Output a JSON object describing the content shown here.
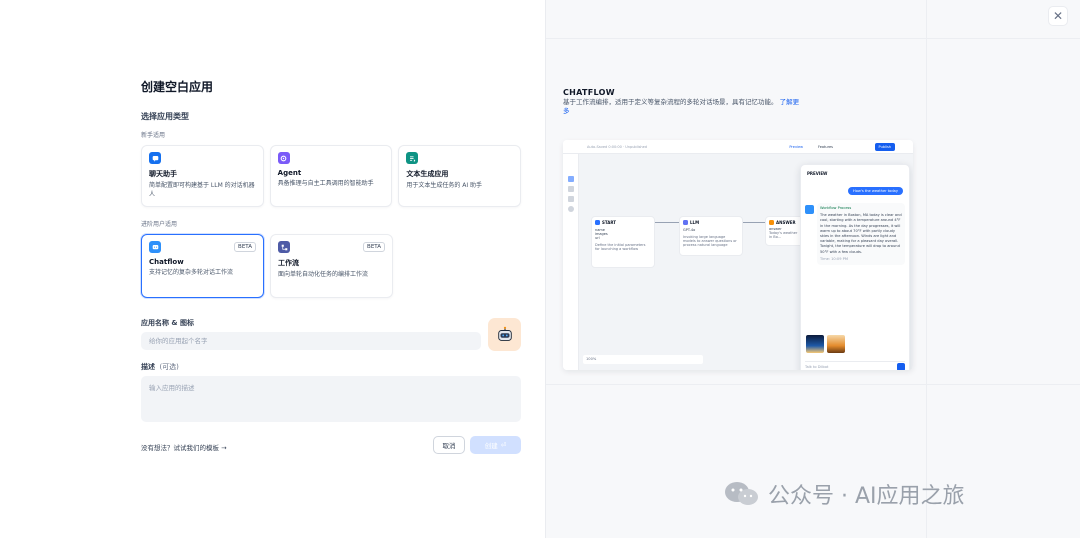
{
  "form": {
    "title": "创建空白应用",
    "type_section": "选择应用类型",
    "beginner_label": "新手适用",
    "advanced_label": "进阶用户适用",
    "beginner_cards": [
      {
        "title": "聊天助手",
        "desc": "简单配置即可构建基于 LLM 的对话机器人",
        "icon": "chat-bubble-icon",
        "color": "#1570ef"
      },
      {
        "title": "Agent",
        "desc": "具备推理与自主工具调用的智能助手",
        "icon": "agent-icon",
        "color": "#7a5af8"
      },
      {
        "title": "文本生成应用",
        "desc": "用于文本生成任务的 AI 助手",
        "icon": "text-generator-icon",
        "color": "#0e9384"
      }
    ],
    "advanced_cards": [
      {
        "title": "Chatflow",
        "desc": "支持记忆的复杂多轮对话工作流",
        "badge": "BETA",
        "icon": "chatflow-icon",
        "color": "#2e90fa"
      },
      {
        "title": "工作流",
        "desc": "面向单轮自动化任务的编排工作流",
        "badge": "BETA",
        "icon": "workflow-icon",
        "color": "#4e5ba6"
      }
    ],
    "name_label": "应用名称 & 图标",
    "name_placeholder": "给你的应用起个名字",
    "avatar_icon": "robot-icon",
    "desc_label": "描述",
    "desc_optional": "(可选)",
    "desc_placeholder": "输入应用的描述",
    "template_link": "没有想法？试试我们的模板",
    "cancel": "取消",
    "create": "创建"
  },
  "preview": {
    "title": "CHATFLOW",
    "desc": "基于工作流编排，适用于定义等复杂流程的多轮对话场景，具有记忆功能。",
    "link": "了解更多",
    "shot": {
      "topbar": "Auto-Saved 0:00:00 · Unpublished",
      "btn_preview": "Preview",
      "btn_features": "Features",
      "btn_publish": "Publish",
      "node_start": "START",
      "start_rows": [
        "name",
        "images",
        "url"
      ],
      "start_note": "Define the initial parameters for launching a workflow",
      "node_llm": "LLM",
      "llm_model": "GPT-4o",
      "llm_note": "Invoking large language models to answer questions or process natural language",
      "node_answer": "ANSWER",
      "answer_label": "answer",
      "answer_text": "Today's weather in Bo...",
      "panel_title": "PREVIEW",
      "user_msg": "How's the weather today",
      "workflow_process": "Workflow Process",
      "bot_answer": "The weather in Boston, MA today is clear and cool, starting with a temperature around 4°F in the morning. As the day progresses, it will warm up to about 70°F with partly cloudy skies in the afternoon. Winds are light and variable, making for a pleasant day overall. Tonight, the temperature will drop to around 50°F with a few clouds.",
      "time": "Time: 10:09 PM",
      "input_placeholder": "Talk to Dilbot",
      "zoom": "100%"
    }
  },
  "watermark": "公众号 · AI应用之旅"
}
